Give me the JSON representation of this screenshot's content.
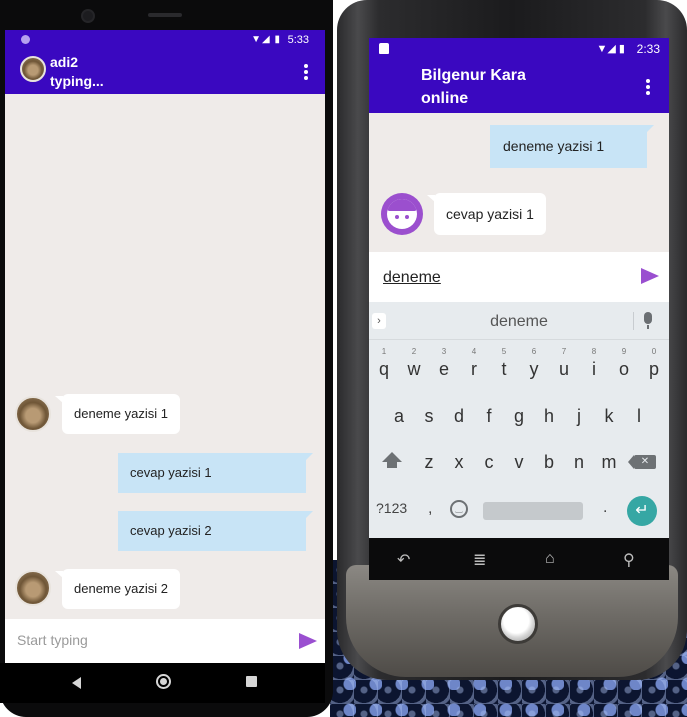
{
  "left_phone": {
    "status": {
      "time": "5:33"
    },
    "header": {
      "name": "adi2",
      "status": "typing..."
    },
    "messages": [
      {
        "direction": "in",
        "text": "deneme yazisi 1"
      },
      {
        "direction": "out",
        "text": "cevap yazisi 1"
      },
      {
        "direction": "out",
        "text": "cevap yazisi 2"
      },
      {
        "direction": "in",
        "text": "deneme yazisi 2"
      }
    ],
    "input": {
      "placeholder": "Start typing"
    }
  },
  "right_phone": {
    "status": {
      "time": "2:33"
    },
    "header": {
      "name": "Bilgenur Kara",
      "status": "online"
    },
    "messages": [
      {
        "direction": "out",
        "text": "deneme yazisi 1"
      },
      {
        "direction": "in",
        "text": "cevap yazisi 1"
      }
    ],
    "input": {
      "value": "deneme"
    },
    "keyboard": {
      "suggestion": "deneme",
      "row1": [
        "q",
        "w",
        "e",
        "r",
        "t",
        "y",
        "u",
        "i",
        "o",
        "p"
      ],
      "row1_hints": [
        "1",
        "2",
        "3",
        "4",
        "5",
        "6",
        "7",
        "8",
        "9",
        "0"
      ],
      "row2": [
        "a",
        "s",
        "d",
        "f",
        "g",
        "h",
        "j",
        "k",
        "l"
      ],
      "row3": [
        "z",
        "x",
        "c",
        "v",
        "b",
        "n",
        "m"
      ],
      "symbols_key": "?123",
      "comma": ",",
      "period": "."
    }
  },
  "colors": {
    "app_bar": "#3a08c0",
    "accent": "#9a4fd0",
    "outgoing_bubble": "#c8e4f6",
    "chat_bg": "#efebe9",
    "enter_key": "#36a7a4"
  }
}
